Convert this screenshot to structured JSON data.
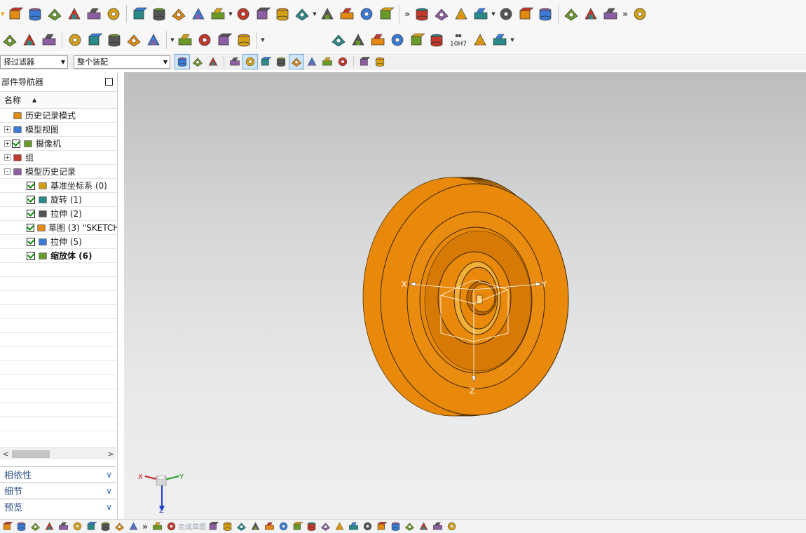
{
  "colors": {
    "model_orange": "#E8890C",
    "model_edge": "#3a2400",
    "viewport_top": "#bcbdbe",
    "viewport_bottom": "#efefef",
    "panel_link": "#2b4f85"
  },
  "toolbar": {
    "row1_icons": [
      "block-icon",
      "cylinder-icon",
      "extrude-icon",
      "revolve-icon",
      "hole-icon",
      "boss-icon",
      "pocket-icon",
      "pad-icon",
      "emboss-icon",
      "offset-face-icon",
      "pattern-icon",
      "boolean-unite-icon",
      "mirror-icon",
      "sweep-icon",
      "thicken-icon",
      "trim-body-icon",
      "split-body-icon",
      "shell-icon",
      "blend-icon",
      "chamfer-icon",
      "draft-icon",
      "move-face-icon",
      "replace-face-icon",
      "delete-face-icon",
      "sync-modeling-icon",
      "surface-icon",
      "through-curves-icon",
      "mesh-surface-icon",
      "section-icon",
      "measure-icon"
    ],
    "row2_icons": [
      "assembly-icon",
      "component-icon",
      "note-icon",
      "add-component-icon",
      "constraint-icon",
      "move-component-icon",
      "pmi-icon",
      "wave-link-icon",
      "curve-icon",
      "spring-icon",
      "gear-icon",
      "fastener-icon",
      "triangle-icon",
      "table-icon",
      "grid-icon",
      "text-icon",
      "pen-icon",
      "dimension-icon",
      "binoculars-icon",
      "weld-icon",
      "weld-assy-icon"
    ],
    "row2_tolerance_label": "10H7",
    "filter_select": "择过滤器",
    "scope_select": "整个装配",
    "row3_icons": [
      "snap-icon",
      "point-icon",
      "line-icon",
      "arc-icon",
      "tangent-icon",
      "endpoint-icon",
      "midpoint-icon",
      "center-icon",
      "quadrant-icon",
      "intersection-icon",
      "exist-point-icon",
      "view-icon",
      "layer-icon"
    ]
  },
  "navigator": {
    "title": "部件导航器",
    "column_name": "名称",
    "tree": [
      {
        "label": "历史记录模式",
        "icon": "clock-icon",
        "level": 0,
        "expander": "",
        "check": false,
        "bold": false
      },
      {
        "label": "模型视图",
        "icon": "model-view-icon",
        "level": 0,
        "expander": "+",
        "check": false,
        "bold": false
      },
      {
        "label": "摄像机",
        "icon": "camera-icon",
        "level": 0,
        "expander": "+",
        "check": true,
        "bold": false
      },
      {
        "label": "组",
        "icon": "folder-icon",
        "level": 0,
        "expander": "+",
        "check": false,
        "bold": false
      },
      {
        "label": "模型历史记录",
        "icon": "folder-open-icon",
        "level": 0,
        "expander": "-",
        "check": false,
        "bold": false
      },
      {
        "label": "基准坐标系 (0)",
        "icon": "datum-csys-icon",
        "level": 1,
        "expander": "",
        "check": true,
        "bold": false
      },
      {
        "label": "旋转 (1)",
        "icon": "revolve-icon",
        "level": 1,
        "expander": "",
        "check": true,
        "bold": false
      },
      {
        "label": "拉伸 (2)",
        "icon": "extrude-icon",
        "level": 1,
        "expander": "",
        "check": true,
        "bold": false
      },
      {
        "label": "草图 (3) \"SKETCH",
        "icon": "sketch-icon",
        "level": 1,
        "expander": "",
        "check": true,
        "bold": false
      },
      {
        "label": "拉伸 (5)",
        "icon": "extrude-icon",
        "level": 1,
        "expander": "",
        "check": true,
        "bold": false
      },
      {
        "label": "缩放体 (6)",
        "icon": "scale-body-icon",
        "level": 1,
        "expander": "",
        "check": true,
        "bold": true
      }
    ],
    "sections": [
      "相依性",
      "细节",
      "预览"
    ]
  },
  "viewport": {
    "csys_axes": [
      "X",
      "Y",
      "Z"
    ],
    "triad_axes": [
      "X",
      "Y",
      "Z"
    ]
  },
  "bottom_bar": {
    "faint_label": "完成草图",
    "icons": [
      "save-icon",
      "assembly-icon",
      "window-icon",
      "add-icon",
      "move-icon",
      "constraint-icon",
      "point-icon",
      "component-icon",
      "model-icon",
      "part-icon",
      "trace-icon",
      "sketch-finish-icon",
      "profile-icon",
      "line-icon",
      "arc-icon",
      "circle-icon",
      "fillet-icon",
      "chamfer-icon",
      "rectangle-icon",
      "polygon-icon",
      "point-icon",
      "offset-icon",
      "trim-icon",
      "extend-icon",
      "corner-icon",
      "constraint-icon",
      "dimension-icon",
      "mirror-icon",
      "pattern-icon",
      "project-icon"
    ]
  }
}
